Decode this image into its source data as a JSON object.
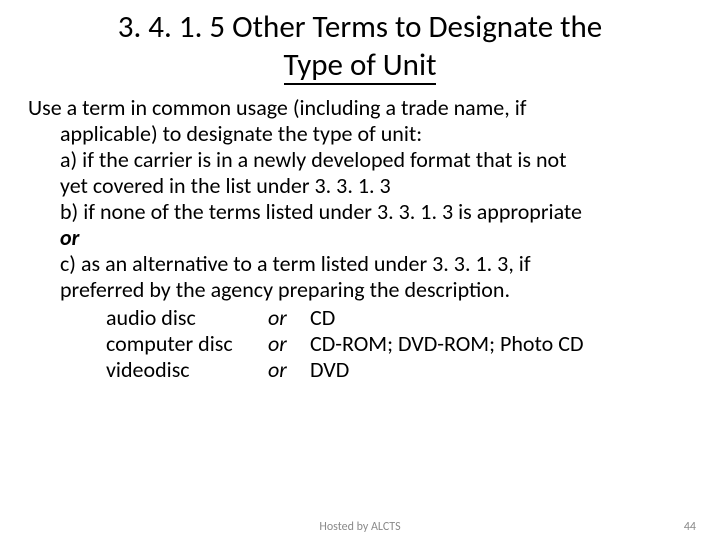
{
  "title_line1": "3. 4. 1. 5  Other Terms to Designate the",
  "title_line2": "Type of Unit",
  "intro": "Use a term in common usage (including a trade name, if",
  "intro_cont": "applicable) to designate the type of unit:",
  "clause_a_1": "a) if the carrier is in a newly developed format that is not",
  "clause_a_2": "yet covered in the list under 3. 3. 1. 3",
  "clause_b": "b) if none of the terms listed under 3. 3. 1. 3 is appropriate",
  "or_word": "or",
  "clause_c_1": "c) as an alternative to a term listed under 3. 3. 1. 3, if",
  "clause_c_2": "preferred by the agency preparing the description.",
  "examples": [
    {
      "left": "audio disc",
      "or": "or",
      "right": "CD"
    },
    {
      "left": "computer disc",
      "or": "or",
      "right": "CD-ROM; DVD-ROM; Photo CD"
    },
    {
      "left": "videodisc",
      "or": "or",
      "right": "DVD"
    }
  ],
  "footer_center": "Hosted by ALCTS",
  "footer_right": "44"
}
